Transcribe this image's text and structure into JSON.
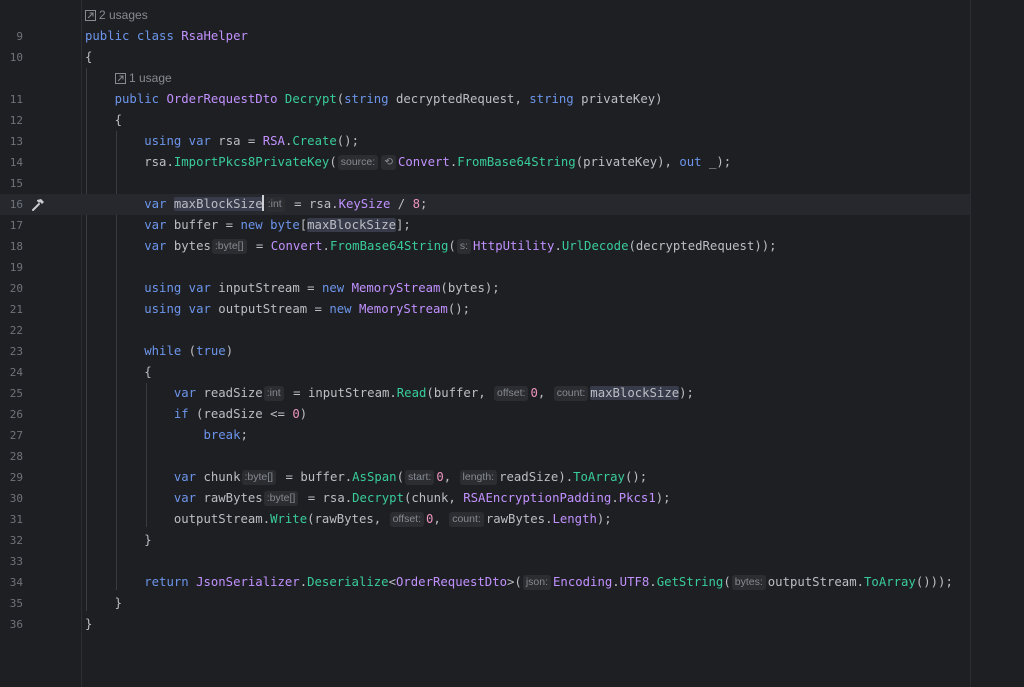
{
  "codelens": {
    "class_usages": "2 usages",
    "method_usages": "1 usage"
  },
  "line_numbers": [
    "9",
    "10",
    "11",
    "12",
    "13",
    "14",
    "15",
    "16",
    "17",
    "18",
    "19",
    "20",
    "21",
    "22",
    "23",
    "24",
    "25",
    "26",
    "27",
    "28",
    "29",
    "30",
    "31",
    "32",
    "33",
    "34",
    "35",
    "36"
  ],
  "tokens": {
    "public": "public",
    "class": "class",
    "classname": "RsaHelper",
    "open_brace": "{",
    "close_brace": "}",
    "return_type": "OrderRequestDto",
    "method_name": "Decrypt",
    "string": "string",
    "param1": "decryptedRequest",
    "param2": "privateKey",
    "using": "using",
    "var": "var",
    "new": "new",
    "byte": "byte",
    "while": "while",
    "true": "true",
    "if": "if",
    "break": "break",
    "return": "return",
    "out": "out",
    "rsa": "rsa",
    "RSA": "RSA",
    "Create": "Create",
    "ImportPkcs8PrivateKey": "ImportPkcs8PrivateKey",
    "Convert": "Convert",
    "FromBase64String": "FromBase64String",
    "maxBlockSize": "maxBlockSize",
    "KeySize": "KeySize",
    "eight": "8",
    "buffer": "buffer",
    "bytes": "bytes",
    "HttpUtility": "HttpUtility",
    "UrlDecode": "UrlDecode",
    "inputStream": "inputStream",
    "outputStream": "outputStream",
    "MemoryStream": "MemoryStream",
    "readSize": "readSize",
    "Read": "Read",
    "zero": "0",
    "chunk": "chunk",
    "AsSpan": "AsSpan",
    "ToArray": "ToArray",
    "rawBytes": "rawBytes",
    "Decrypt": "Decrypt",
    "RSAEncryptionPadding": "RSAEncryptionPadding",
    "Pkcs1": "Pkcs1",
    "Write": "Write",
    "Length": "Length",
    "JsonSerializer": "JsonSerializer",
    "Deserialize": "Deserialize",
    "Encoding": "Encoding",
    "UTF8": "UTF8",
    "GetString": "GetString"
  },
  "hints": {
    "source": "source:",
    "int": ":int",
    "byte_arr": ":byte[]",
    "s": "s:",
    "offset": "offset:",
    "count": "count:",
    "start": "start:",
    "length": "length:",
    "json": "json:",
    "bytes": "bytes:"
  },
  "colors": {
    "background": "#1e1f22",
    "keyword": "#6c95eb",
    "type": "#c191ff",
    "method": "#39cc9b",
    "number": "#ed94c0",
    "text": "#bcbec4",
    "hint": "#868a91"
  }
}
